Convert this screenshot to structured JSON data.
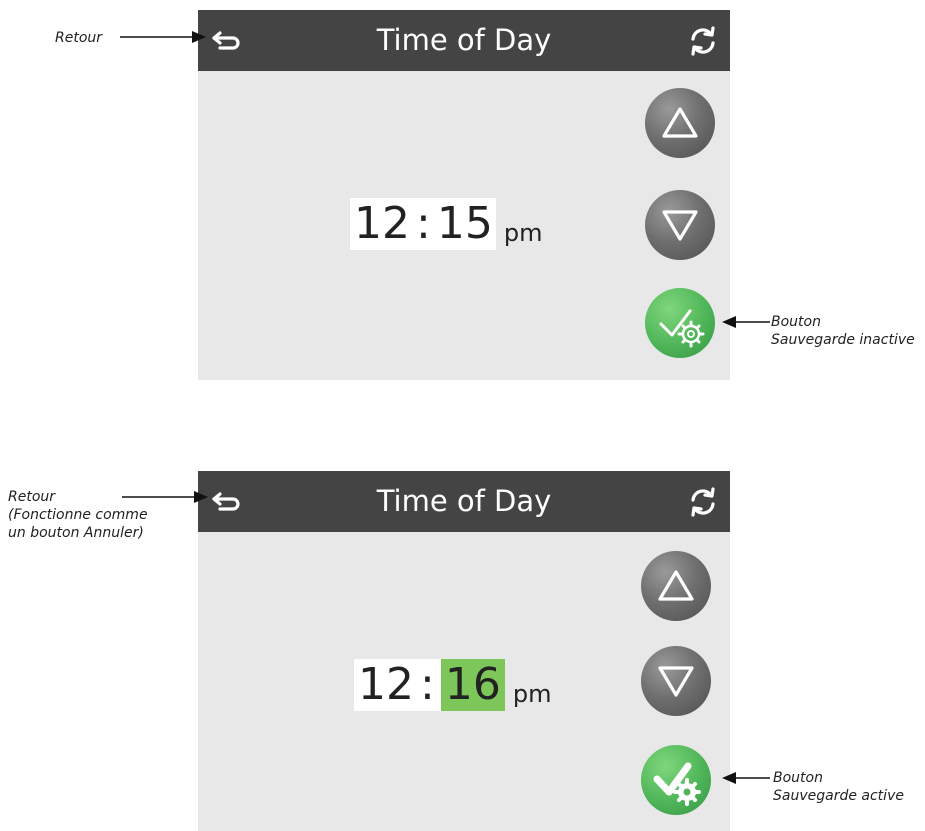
{
  "screen_top": {
    "title": "Time of Day",
    "time": {
      "hours": "12",
      "separator": ":",
      "minutes": "15",
      "ampm": "pm"
    },
    "save_state": "inactive"
  },
  "screen_bottom": {
    "title": "Time of Day",
    "time": {
      "hours": "12",
      "separator": ":",
      "minutes": "16",
      "ampm": "pm"
    },
    "save_state": "active"
  },
  "annotations": {
    "top_back": "Retour",
    "top_save_line1": "Bouton",
    "top_save_line2": "Sauvegarde inactive",
    "bottom_back_line1": "Retour",
    "bottom_back_line2": "(Fonctionne comme",
    "bottom_back_line3": "un bouton Annuler)",
    "bottom_save_line1": "Bouton",
    "bottom_save_line2": "Sauvegarde active"
  },
  "icons": {
    "back": "back-arrow-icon",
    "refresh": "refresh-icon",
    "up": "triangle-up-icon",
    "down": "triangle-down-icon",
    "save": "check-gear-icon"
  },
  "colors": {
    "header": "#444444",
    "panel": "#e8e8e8",
    "highlight": "#7cc65a",
    "save_green": "#4fb558"
  }
}
